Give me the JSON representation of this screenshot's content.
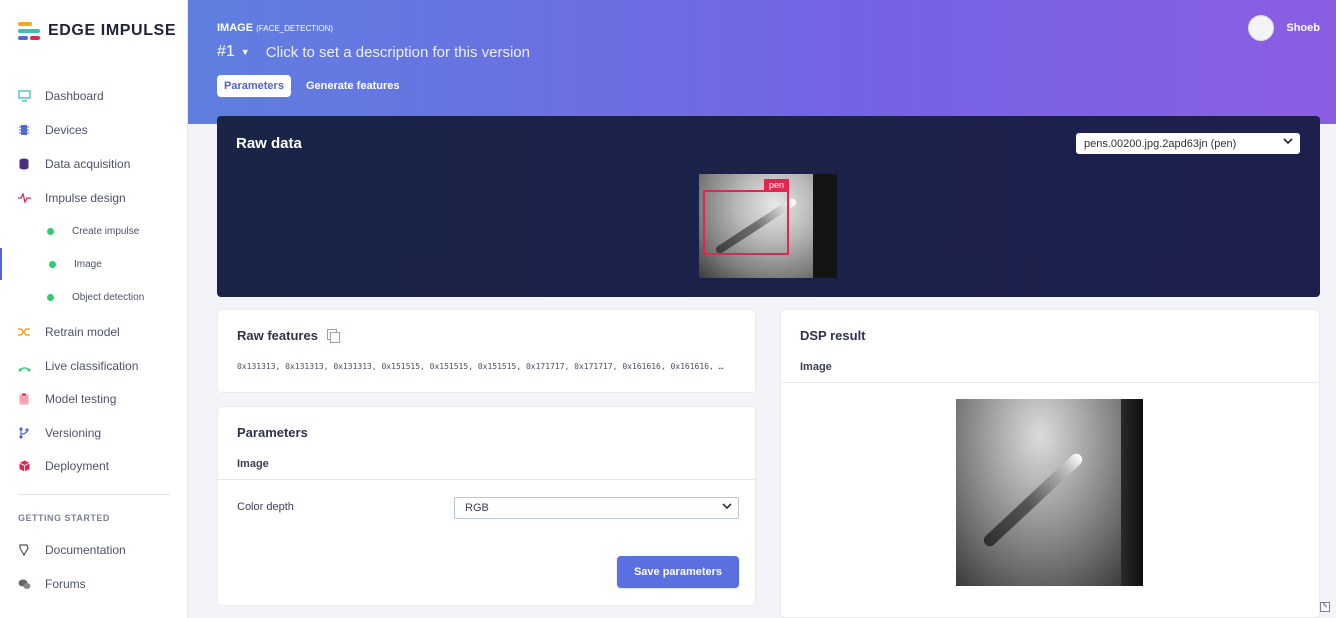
{
  "app": {
    "brand": "EDGE IMPULSE",
    "brand_colors": [
      "#f5a623",
      "#3cbfb4",
      "#5368d8",
      "#e5254e"
    ]
  },
  "sidebar": {
    "items": [
      {
        "label": "Dashboard",
        "icon": "monitor-icon",
        "color": "#3cbfb4"
      },
      {
        "label": "Devices",
        "icon": "chip-icon",
        "color": "#5368d8"
      },
      {
        "label": "Data acquisition",
        "icon": "database-icon",
        "color": "#4a2e83"
      },
      {
        "label": "Impulse design",
        "icon": "pulse-icon",
        "color": "#e5254e"
      },
      {
        "label": "Create impulse",
        "icon": "dot-icon",
        "color": "#2ecc71"
      },
      {
        "label": "Image",
        "icon": "dot-icon",
        "color": "#2ecc71",
        "active": true
      },
      {
        "label": "Object detection",
        "icon": "dot-icon",
        "color": "#2ecc71"
      },
      {
        "label": "Retrain model",
        "icon": "shuffle-icon",
        "color": "#f5a623"
      },
      {
        "label": "Live classification",
        "icon": "signal-icon",
        "color": "#2ecc71"
      },
      {
        "label": "Model testing",
        "icon": "clipboard-icon",
        "color": "#e5254e"
      },
      {
        "label": "Versioning",
        "icon": "branch-icon",
        "color": "#5368d8"
      },
      {
        "label": "Deployment",
        "icon": "box-icon",
        "color": "#e5254e"
      }
    ],
    "section": "GETTING STARTED",
    "getting_started": [
      {
        "label": "Documentation",
        "icon": "docs-icon"
      },
      {
        "label": "Forums",
        "icon": "chat-icon"
      }
    ]
  },
  "header": {
    "block_name": "IMAGE",
    "block_variant": "(FACE_DETECTION)",
    "version": "#1",
    "version_desc": "Click to set a description for this version",
    "tabs": [
      "Parameters",
      "Generate features"
    ],
    "active_tab": "Parameters",
    "user": "Shoeb"
  },
  "raw_data": {
    "title": "Raw data",
    "sample": "pens.00200.jpg.2apd63jn (pen)",
    "label": "pen"
  },
  "raw_features": {
    "title": "Raw features",
    "values": "0x131313, 0x131313, 0x131313, 0x151515, 0x151515, 0x151515, 0x171717, 0x171717, 0x161616, 0x161616, …"
  },
  "parameters": {
    "title": "Parameters",
    "subtitle": "Image",
    "color_depth_label": "Color depth",
    "color_depth_value": "RGB",
    "save_label": "Save parameters"
  },
  "dsp_result": {
    "title": "DSP result",
    "subtitle": "Image"
  }
}
